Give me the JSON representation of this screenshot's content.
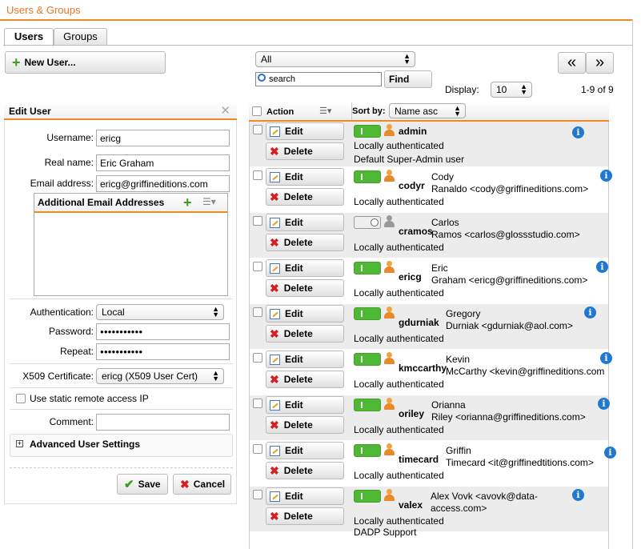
{
  "app": {
    "title": "Users & Groups"
  },
  "tabs": [
    {
      "label": "Users"
    },
    {
      "label": "Groups"
    }
  ],
  "toolbar": {
    "new_user": "New User...",
    "filter_value": "All",
    "search_placeholder": "search",
    "find": "Find",
    "display_label": "Display:",
    "display_value": "10",
    "range": "1-9 of 9",
    "first": "«",
    "last": "»"
  },
  "edit_user": {
    "title": "Edit User",
    "username_label": "Username:",
    "username": "ericg",
    "realname_label": "Real name:",
    "realname": "Eric Graham",
    "email_label": "Email address:",
    "email": "ericg@griffineditions.com",
    "additional_title": "Additional Email Addresses",
    "auth_label": "Authentication:",
    "auth_value": "Local",
    "password_label": "Password:",
    "password": "●●●●●●●●●●●",
    "repeat_label": "Repeat:",
    "repeat": "●●●●●●●●●●●",
    "x509_label": "X509 Certificate:",
    "x509_value": "ericg (X509 User Cert)",
    "static_ip_label": "Use static remote access IP",
    "comment_label": "Comment:",
    "comment": "",
    "advanced": "Advanced User Settings",
    "save": "Save",
    "cancel": "Cancel"
  },
  "grid": {
    "action_header": "Action",
    "sort_label": "Sort by:",
    "sort_value": "Name asc",
    "edit_label": "Edit",
    "delete_label": "Delete",
    "rows": [
      {
        "username": "admin",
        "line1": "",
        "line2": "",
        "auth": "Locally authenticated",
        "extra": "Default Super-Admin user",
        "enabled": true
      },
      {
        "username": "codyr",
        "line1": "Cody",
        "line2": "Ranaldo <cody@griffineditions.com>",
        "auth": "Locally authenticated",
        "extra": "",
        "enabled": true
      },
      {
        "username": "cramos",
        "line1": "Carlos",
        "line2": "Ramos <carlos@glossstudio.com>",
        "auth": "Locally authenticated",
        "extra": "",
        "enabled": false
      },
      {
        "username": "ericg",
        "line1": "Eric",
        "line2": "Graham <ericg@griffineditions.com>",
        "auth": "Locally authenticated",
        "extra": "",
        "enabled": true
      },
      {
        "username": "gdurniak",
        "line1": "Gregory",
        "line2": "Durniak <gdurniak@aol.com>",
        "auth": "Locally authenticated",
        "extra": "",
        "enabled": true
      },
      {
        "username": "kmccarthy",
        "line1": "Kevin",
        "line2": "McCarthy <kevin@griffineditions.com",
        "auth": "Locally authenticated",
        "extra": "",
        "enabled": true
      },
      {
        "username": "oriley",
        "line1": "Orianna",
        "line2": "Riley <orianna@griffineditions.com>",
        "auth": "Locally authenticated",
        "extra": "",
        "enabled": true
      },
      {
        "username": "timecard",
        "line1": "Griffin",
        "line2": "Timecard <it@griffinedtitions.com>",
        "auth": "Locally authenticated",
        "extra": "",
        "enabled": true
      },
      {
        "username": "valex",
        "line1": "Alex Vovk <avovk@data-",
        "line2": "access.com>",
        "auth": "Locally authenticated",
        "extra": "DADP Support",
        "enabled": true
      }
    ]
  },
  "colors": {
    "accent": "#f08a24",
    "toggle_on": "#4db834",
    "info": "#1f78d1"
  }
}
